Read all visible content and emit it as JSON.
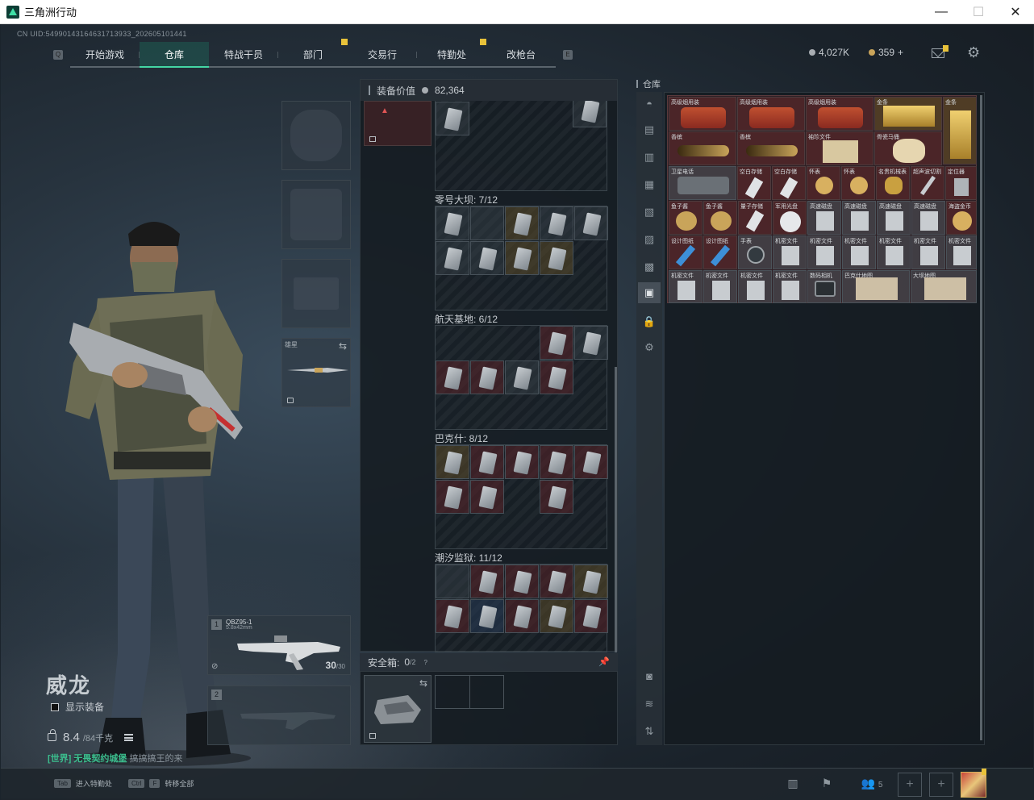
{
  "window": {
    "title": "三角洲行动",
    "minimize": "—",
    "maximize": "☐",
    "close": "✕"
  },
  "uid": "CN UID:54990143164631713933_202605101441",
  "nav": {
    "tabs": [
      {
        "label": "开始游戏",
        "active": false,
        "badge": false
      },
      {
        "label": "仓库",
        "active": true,
        "badge": false
      },
      {
        "label": "特战干员",
        "active": false,
        "badge": false
      },
      {
        "label": "部门",
        "active": false,
        "badge": true
      },
      {
        "label": "交易行",
        "active": false,
        "badge": false
      },
      {
        "label": "特勤处",
        "active": false,
        "badge": true
      },
      {
        "label": "改枪台",
        "active": false,
        "badge": false
      }
    ]
  },
  "currency": {
    "silver": "4,027K",
    "gold": "359",
    "gold_add": "+"
  },
  "operator": {
    "name": "威龙",
    "show_gear": "显示装备",
    "weight_value": "8.4",
    "weight_max": "/84千克",
    "ticker_highlight": "[世界] 无畏契约城堡",
    "ticker_rest": "搞搞搞王的来"
  },
  "gear": {
    "melee_label": "雄星"
  },
  "weapons": {
    "primary": {
      "slot": "1",
      "name": "QBZ95-1",
      "caliber": "5.8x42mm",
      "ammo": "30",
      "ammo_max": "/30"
    },
    "secondary": {
      "slot": "2"
    }
  },
  "equipment": {
    "header": "装备价值",
    "value": "82,364",
    "cases": [
      {
        "title": "零号大坝: 7/12"
      },
      {
        "title": "航天基地: 6/12"
      },
      {
        "title": "巴克什: 8/12"
      },
      {
        "title": "潮汐监狱: 11/12"
      }
    ]
  },
  "safe_box": {
    "label": "安全箱:",
    "value": "0",
    "max": "/2",
    "help": "?"
  },
  "stash": {
    "title": "仓库",
    "items": [
      {
        "label": "高级烟用装"
      },
      {
        "label": "高级烟用装"
      },
      {
        "label": "高级烟用装"
      },
      {
        "label": "金条"
      },
      {
        "label": "金条"
      },
      {
        "label": "香槟"
      },
      {
        "label": "香槟"
      },
      {
        "label": "袖珍文件"
      },
      {
        "label": "骨瓷马俑"
      },
      {
        "label": "卫星电话"
      },
      {
        "label": "空白存储"
      },
      {
        "label": "空白存储"
      },
      {
        "label": "怀表"
      },
      {
        "label": "怀表"
      },
      {
        "label": "名贵机械表"
      },
      {
        "label": "超声波切割"
      },
      {
        "label": "定位器"
      },
      {
        "label": "鱼子酱"
      },
      {
        "label": "鱼子酱"
      },
      {
        "label": "量子存储"
      },
      {
        "label": "军用光盘"
      },
      {
        "label": "高速磁盘"
      },
      {
        "label": "高速磁盘"
      },
      {
        "label": "高速磁盘"
      },
      {
        "label": "高速磁盘"
      },
      {
        "label": "海盗金币"
      },
      {
        "label": "设计图纸"
      },
      {
        "label": "设计图纸"
      },
      {
        "label": "手表"
      },
      {
        "label": "机密文件"
      },
      {
        "label": "机密文件"
      },
      {
        "label": "机密文件"
      },
      {
        "label": "机密文件"
      },
      {
        "label": "机密文件"
      },
      {
        "label": "机密文件"
      },
      {
        "label": "机密文件"
      },
      {
        "label": "机密文件"
      },
      {
        "label": "机密文件"
      },
      {
        "label": "机密文件"
      },
      {
        "label": "数码相机"
      },
      {
        "label": "巴克什地图"
      },
      {
        "label": "大坝地图"
      }
    ]
  },
  "bottom": {
    "hint1_key": "Tab",
    "hint1_text": "进入特勤处",
    "hint2_key": "Ctrl",
    "hint2_key2": "F",
    "hint2_text": "转移全部",
    "friends_count": "5"
  }
}
